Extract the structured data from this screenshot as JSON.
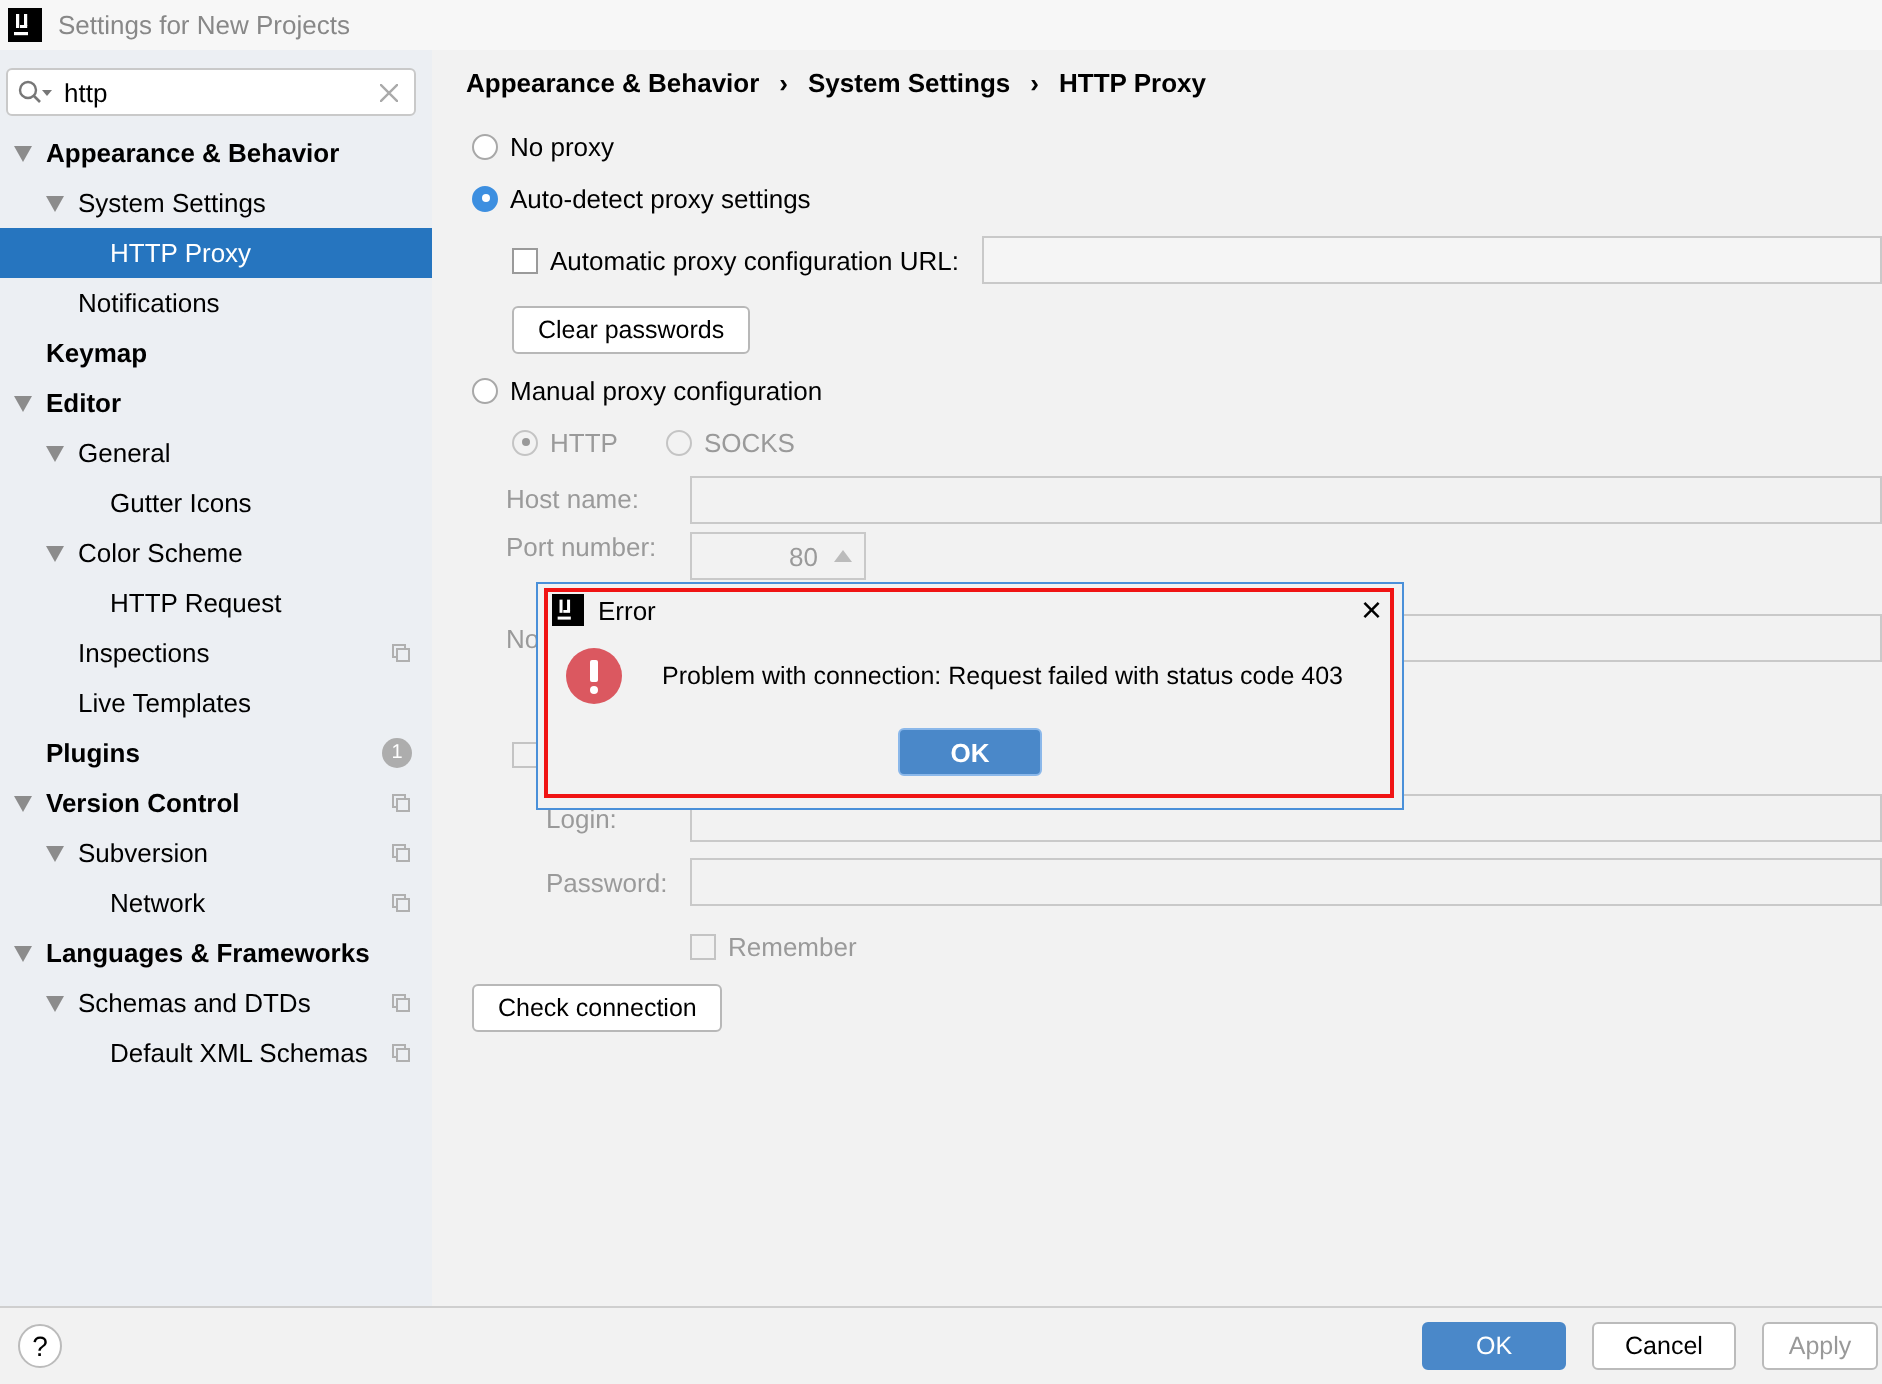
{
  "window": {
    "title": "Settings for New Projects"
  },
  "search": {
    "value": "http"
  },
  "tree": [
    {
      "label": "Appearance & Behavior",
      "expanded": true,
      "selected": false,
      "children": [
        {
          "label": "System Settings",
          "expanded": true,
          "selected": false,
          "children": [
            {
              "label": "HTTP Proxy",
              "selected": true
            }
          ]
        },
        {
          "label": "Notifications",
          "selected": false
        }
      ]
    },
    {
      "label": "Keymap",
      "selected": false
    },
    {
      "label": "Editor",
      "expanded": true,
      "selected": false,
      "children": [
        {
          "label": "General",
          "expanded": true,
          "selected": false,
          "children": [
            {
              "label": "Gutter Icons",
              "selected": false
            }
          ]
        },
        {
          "label": "Color Scheme",
          "expanded": true,
          "selected": false,
          "children": [
            {
              "label": "HTTP Request",
              "selected": false
            }
          ]
        },
        {
          "label": "Inspections",
          "selected": false,
          "project_level": true
        },
        {
          "label": "Live Templates",
          "selected": false
        }
      ]
    },
    {
      "label": "Plugins",
      "selected": false,
      "badge": "1"
    },
    {
      "label": "Version Control",
      "expanded": true,
      "selected": false,
      "project_level": true,
      "children": [
        {
          "label": "Subversion",
          "expanded": true,
          "selected": false,
          "project_level": true,
          "children": [
            {
              "label": "Network",
              "selected": false,
              "project_level": true
            }
          ]
        }
      ]
    },
    {
      "label": "Languages & Frameworks",
      "expanded": true,
      "selected": false,
      "children": [
        {
          "label": "Schemas and DTDs",
          "expanded": true,
          "selected": false,
          "project_level": true,
          "children": [
            {
              "label": "Default XML Schemas",
              "selected": false,
              "project_level": true
            }
          ]
        }
      ]
    }
  ],
  "breadcrumb": [
    "Appearance & Behavior",
    "System Settings",
    "HTTP Proxy"
  ],
  "breadcrumb_separator": "›",
  "proxy_modes": [
    {
      "label": "No proxy",
      "selected": false
    },
    {
      "label": "Auto-detect proxy settings",
      "selected": true
    },
    {
      "label": "Manual proxy configuration",
      "selected": false
    }
  ],
  "auto_config": {
    "label": "Automatic proxy configuration URL:",
    "checked": false
  },
  "clear_passwords": "Clear passwords",
  "manual": {
    "disabled": true,
    "protocols": [
      {
        "label": "HTTP",
        "selected": true
      },
      {
        "label": "SOCKS",
        "selected": false
      }
    ],
    "host_label": "Host name:",
    "port_label": "Port number:",
    "port_value": "80",
    "no_proxy_label": "No",
    "auth_checked": false,
    "login_label": "Login:",
    "password_label": "Password:",
    "remember": {
      "label": "Remember",
      "checked": false
    }
  },
  "check_connection": "Check connection",
  "dialog": {
    "title": "Error",
    "message": "Problem with connection: Request failed with status code 403",
    "button": "OK",
    "close": "×"
  },
  "footer": {
    "help": "?",
    "buttons": [
      {
        "label": "OK",
        "primary": true
      },
      {
        "label": "Cancel",
        "primary": false
      },
      {
        "label": "Apply",
        "primary": false
      }
    ]
  }
}
